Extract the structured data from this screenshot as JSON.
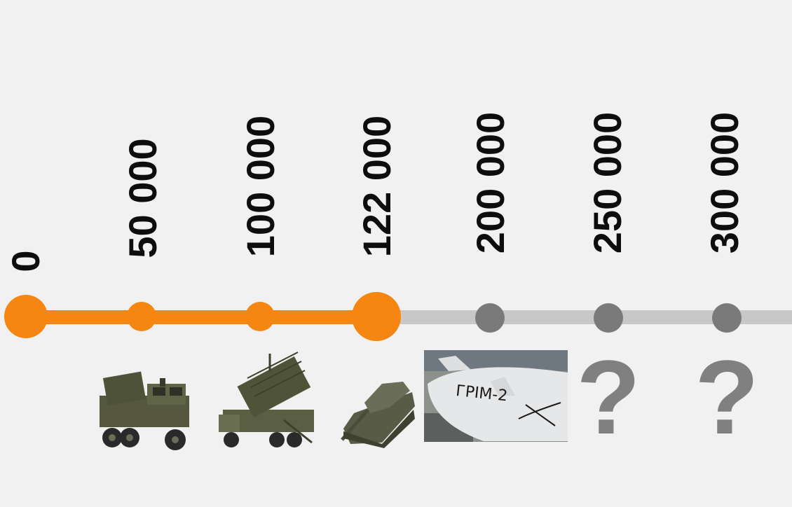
{
  "milestones": [
    {
      "label": "0",
      "reached": true,
      "marker": "large"
    },
    {
      "label": "50 000",
      "reached": true,
      "marker": "small",
      "image": "himars-launcher-icon"
    },
    {
      "label": "100 000",
      "reached": true,
      "marker": "small",
      "image": "patriot-system-icon"
    },
    {
      "label": "122 000",
      "reached": true,
      "marker": "large",
      "image": "tank-icon"
    },
    {
      "label": "200 000",
      "reached": false,
      "marker": "small",
      "image": "missile-photo",
      "image_text": "ГРІМ-2"
    },
    {
      "label": "250 000",
      "reached": false,
      "marker": "small",
      "image": "question-mark",
      "image_text": "?"
    },
    {
      "label": "300 000",
      "reached": false,
      "marker": "small",
      "image": "question-mark",
      "image_text": "?"
    }
  ],
  "colors": {
    "reached": "#f58612",
    "pending": "#7a7a7a",
    "pending_line": "#c8c8c8",
    "background": "#f1f1f1",
    "text": "#0d0d0d"
  }
}
